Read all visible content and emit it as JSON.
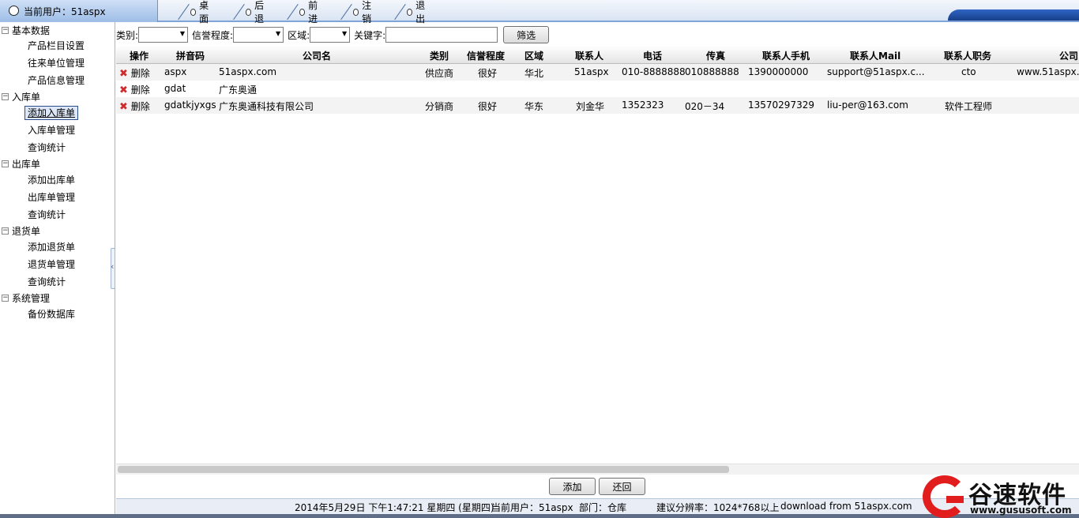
{
  "topbar": {
    "user_label": "当前用户：51aspx",
    "nav": [
      "桌面",
      "后退",
      "前进",
      "注销",
      "退出"
    ]
  },
  "sidebar": {
    "groups": [
      {
        "label": "基本数据",
        "items": [
          "产品栏目设置",
          "往来单位管理",
          "产品信息管理"
        ]
      },
      {
        "label": "入库单",
        "items": [
          "添加入库单",
          "入库单管理",
          "查询统计"
        ]
      },
      {
        "label": "出库单",
        "items": [
          "添加出库单",
          "出库单管理",
          "查询统计"
        ]
      },
      {
        "label": "退货单",
        "items": [
          "添加退货单",
          "退货单管理",
          "查询统计"
        ]
      },
      {
        "label": "系统管理",
        "items": [
          "备份数据库"
        ]
      }
    ],
    "selected": "添加入库单"
  },
  "filter": {
    "category_label": "类别:",
    "credit_label": "信誉程度:",
    "region_label": "区域:",
    "keyword_label": "关键字:",
    "keyword_value": "",
    "filter_button": "筛选"
  },
  "table": {
    "headers": [
      "操作",
      "拼音码",
      "公司名",
      "类别",
      "信誉程度",
      "区域",
      "联系人",
      "电话",
      "传真",
      "联系人手机",
      "联系人Mail",
      "联系人职务",
      "公司"
    ],
    "delete_label": "删除",
    "rows": [
      {
        "pinyin": "aspx",
        "company": "51aspx.com",
        "category": "供应商",
        "credit": "很好",
        "region": "华北",
        "contact": "51aspx",
        "phone": "010-8888888",
        "fax": "010888888",
        "mobile": "1390000000",
        "mail": "support@51aspx.c...",
        "title": "cto",
        "site": "www.51aspx.c"
      },
      {
        "pinyin": "gdat",
        "company": "广东奥通",
        "category": "",
        "credit": "",
        "region": "",
        "contact": "",
        "phone": "",
        "fax": "",
        "mobile": "",
        "mail": "",
        "title": "",
        "site": ""
      },
      {
        "pinyin": "gdatkjyxgs",
        "company": "广东奥通科技有限公司",
        "category": "分销商",
        "credit": "很好",
        "region": "华东",
        "contact": "刘金华",
        "phone": "1352323",
        "fax": "020－34",
        "mobile": "13570297329",
        "mail": "liu-per@163.com",
        "title": "软件工程师",
        "site": ""
      }
    ]
  },
  "buttons": {
    "add": "添加",
    "restore": "还回"
  },
  "status": {
    "datetime": "2014年5月29日 下午1:47:21 星期四 (星期四)",
    "user": "当前用户：51aspx",
    "dept": "部门：仓库",
    "resolution": "建议分辨率：1024*768以上",
    "download": "download from 51aspx.com"
  },
  "watermark": {
    "name": "谷速软件",
    "url": "www.gususoft.com"
  }
}
